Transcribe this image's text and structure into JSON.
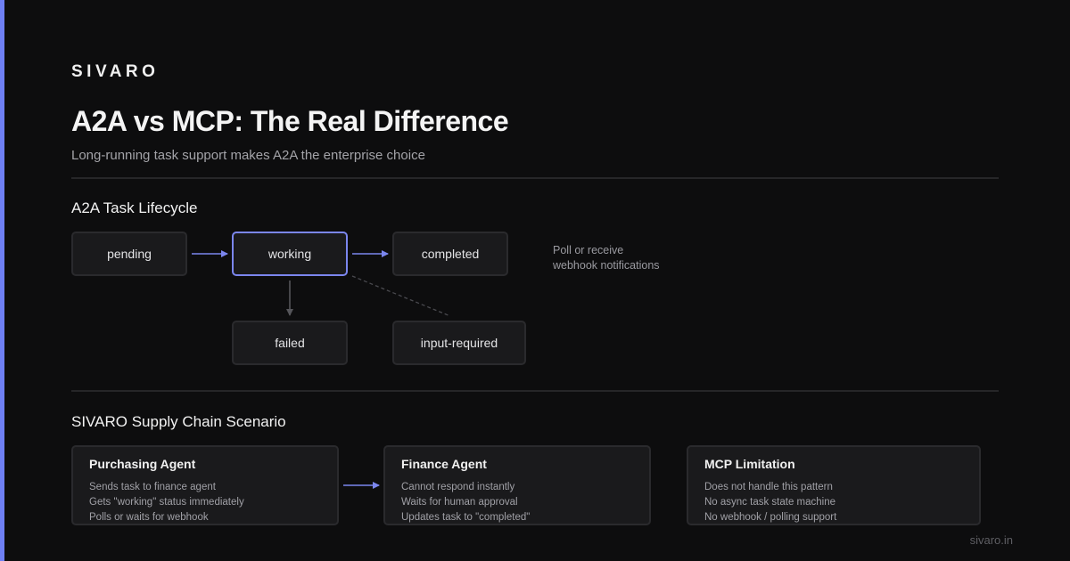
{
  "brand": "SIVARO",
  "title": "A2A vs MCP: The Real Difference",
  "subtitle": "Long-running task support makes A2A the enterprise choice",
  "lifecycle": {
    "heading": "A2A Task Lifecycle",
    "states": {
      "pending": "pending",
      "working": "working",
      "completed": "completed",
      "failed": "failed",
      "input_required": "input-required"
    },
    "note_lines": [
      "Poll or receive",
      "webhook notifications"
    ]
  },
  "scenario": {
    "heading": "SIVARO Supply Chain Scenario",
    "cards": [
      {
        "title": "Purchasing Agent",
        "lines": [
          "Sends task to finance agent",
          "Gets \"working\" status immediately",
          "Polls or waits for webhook"
        ]
      },
      {
        "title": "Finance Agent",
        "lines": [
          "Cannot respond instantly",
          "Waits for human approval",
          "Updates task to \"completed\""
        ]
      },
      {
        "title": "MCP Limitation",
        "lines": [
          "Does not handle this pattern",
          "No async task state machine",
          "No webhook / polling support"
        ]
      }
    ]
  },
  "footer": "sivaro.in",
  "colors": {
    "accent": "#6e7ff3",
    "background": "#0d0d0e",
    "box": "#1a1a1c",
    "box_border": "#2a2a2d"
  }
}
